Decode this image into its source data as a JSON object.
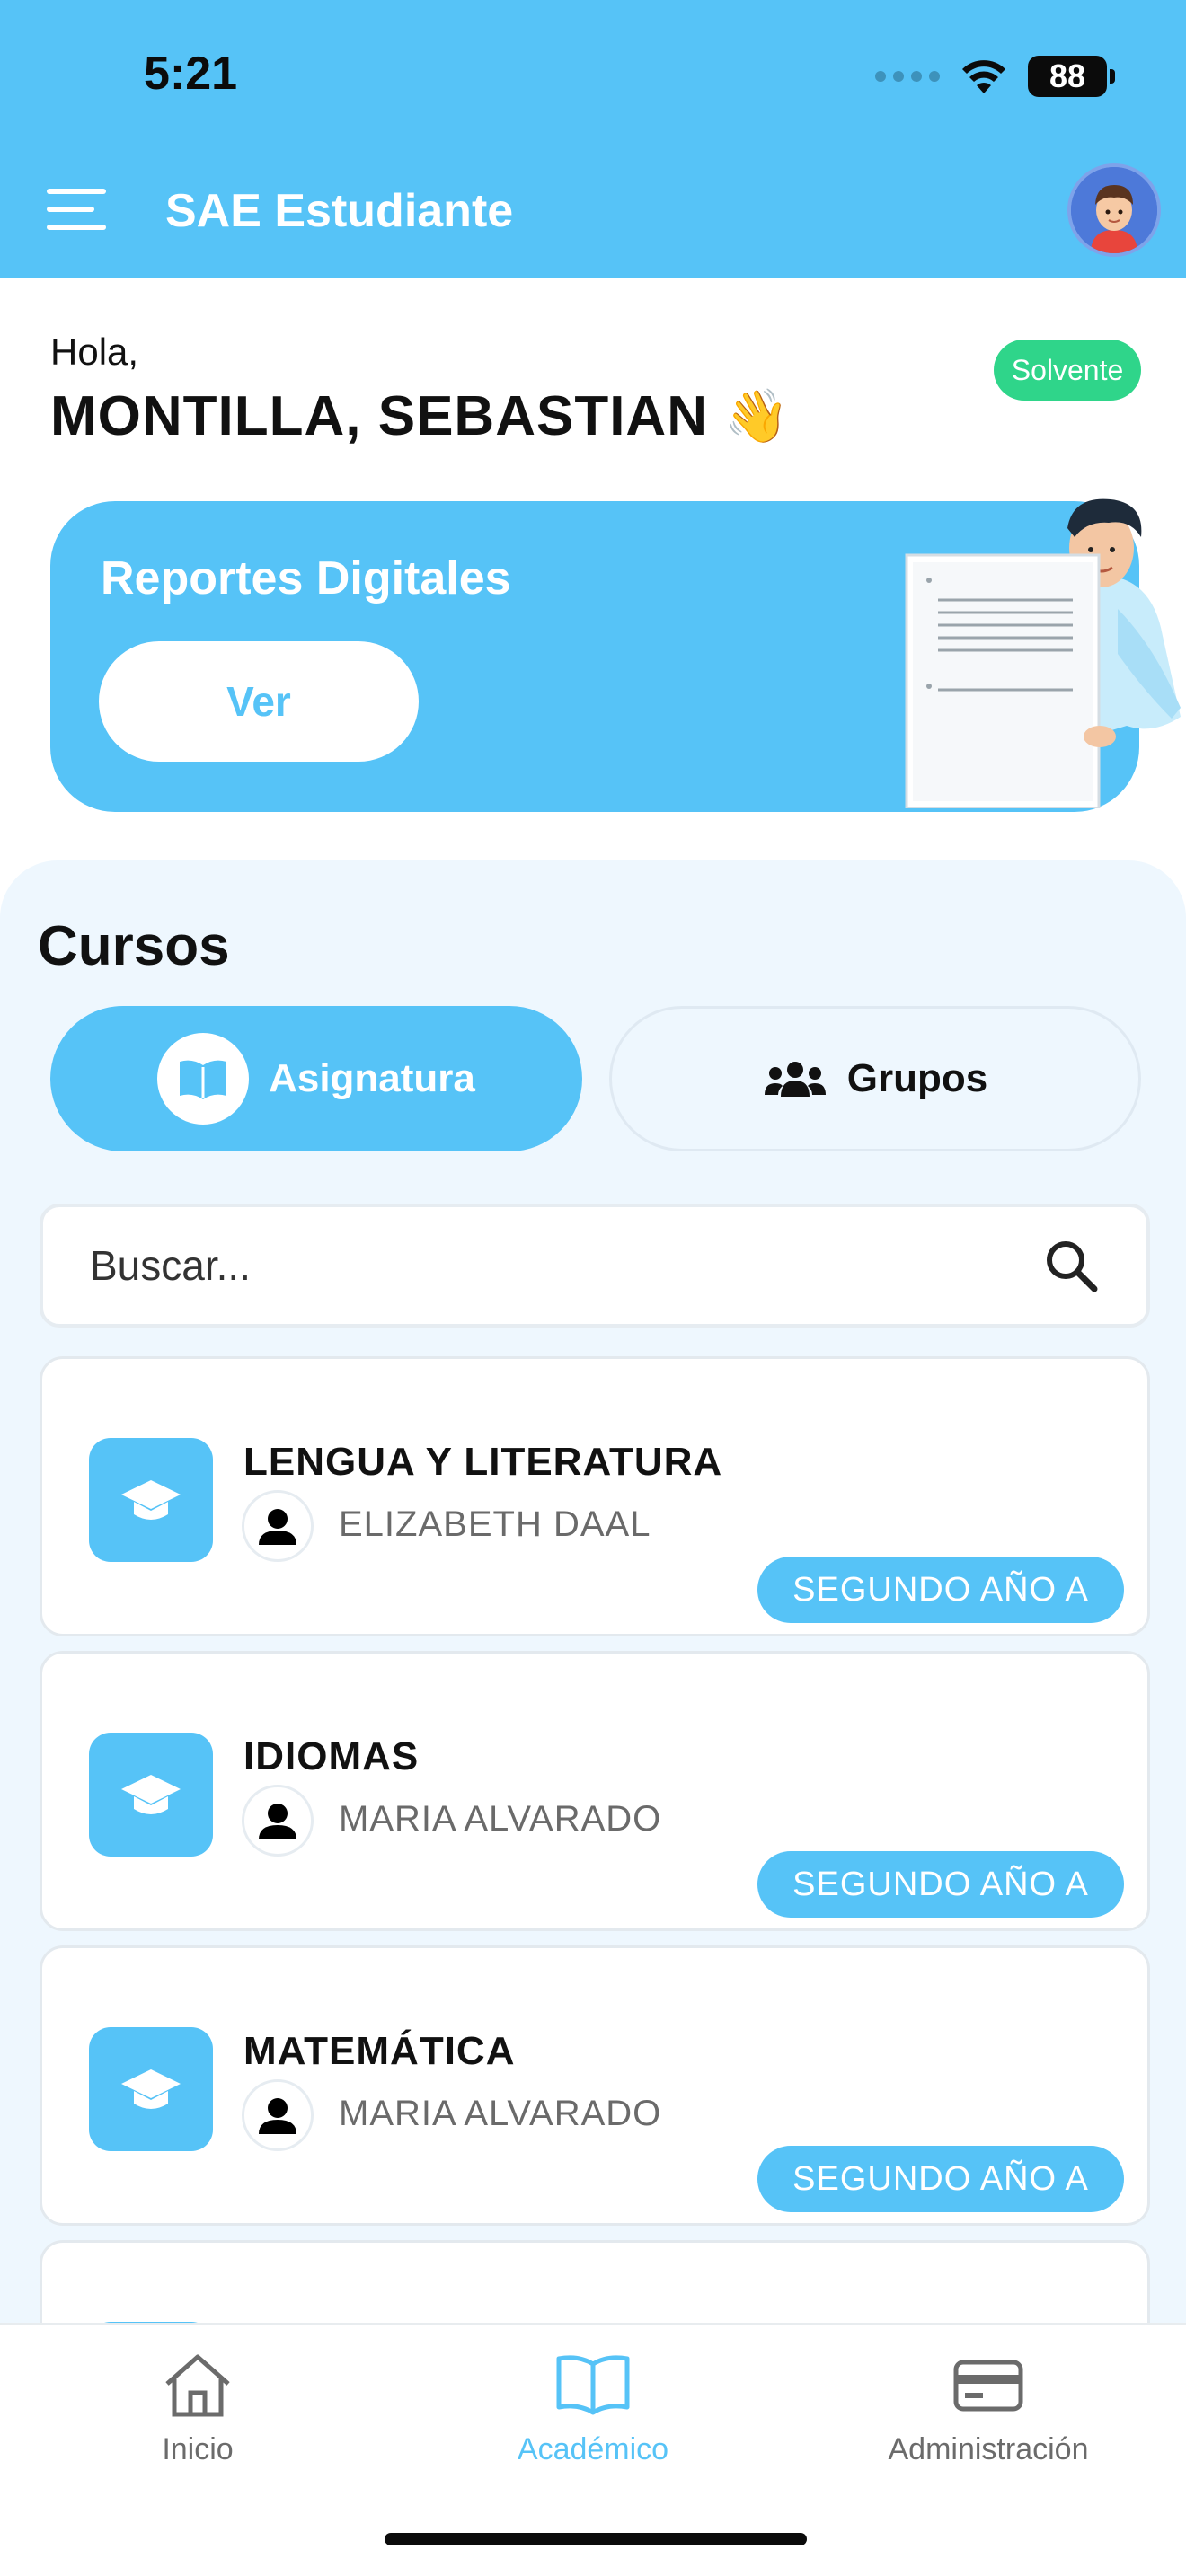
{
  "status_bar": {
    "time": "5:21",
    "battery": "88"
  },
  "header": {
    "title": "SAE Estudiante"
  },
  "greeting": {
    "hello": "Hola,",
    "student_name": "MONTILLA, SEBASTIAN",
    "wave": "👋",
    "status_badge": "Solvente"
  },
  "banner": {
    "title": "Reportes Digitales",
    "button": "Ver"
  },
  "courses": {
    "title": "Cursos",
    "tabs": [
      {
        "label": "Asignatura",
        "icon": "open-book-icon",
        "active": true
      },
      {
        "label": "Grupos",
        "icon": "users-group-icon",
        "active": false
      }
    ],
    "search": {
      "placeholder": "Buscar..."
    },
    "items": [
      {
        "name": "LENGUA Y LITERATURA",
        "teacher": "ELIZABETH DAAL",
        "grade": "SEGUNDO AÑO A",
        "icon": "graduation-cap-icon"
      },
      {
        "name": "IDIOMAS",
        "teacher": "MARIA ALVARADO",
        "grade": "SEGUNDO AÑO A",
        "icon": "graduation-cap-icon"
      },
      {
        "name": "MATEMÁTICA",
        "teacher": "MARIA ALVARADO",
        "grade": "SEGUNDO AÑO A",
        "icon": "graduation-cap-icon"
      }
    ]
  },
  "bottom_nav": [
    {
      "label": "Inicio",
      "icon": "home-icon",
      "active": false
    },
    {
      "label": "Académico",
      "icon": "book-icon",
      "active": true
    },
    {
      "label": "Administración",
      "icon": "credit-card-icon",
      "active": false
    }
  ],
  "colors": {
    "primary": "#56c3f7",
    "success": "#2fd58a",
    "panel": "#eef7fe"
  }
}
